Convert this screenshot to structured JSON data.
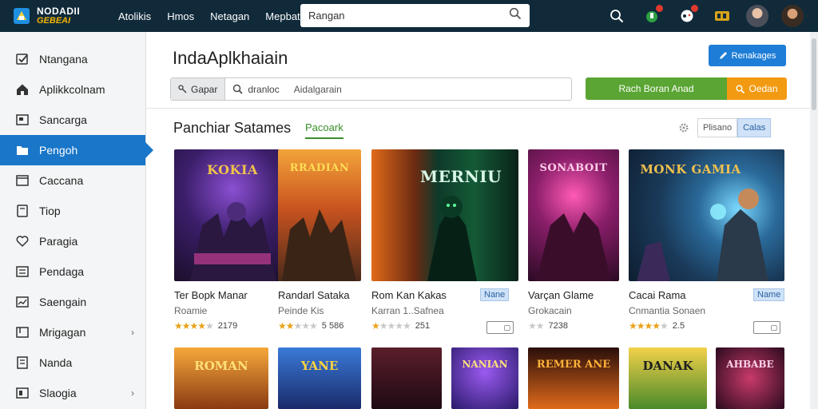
{
  "app": {
    "logo_line1": "NODADII",
    "logo_line2": "GEBEAI"
  },
  "topnav": [
    "Atolikis",
    "Hmos",
    "Netagan",
    "Mepbat"
  ],
  "top_search": {
    "value": "Rangan"
  },
  "sidebar": {
    "items": [
      {
        "label": "Ntangana",
        "icon": "checkbox-icon",
        "chevron": false,
        "active": false
      },
      {
        "label": "Aplikkcolnam",
        "icon": "home-icon",
        "chevron": false,
        "active": false
      },
      {
        "label": "Sancarga",
        "icon": "screen-icon",
        "chevron": false,
        "active": false
      },
      {
        "label": "Pengoh",
        "icon": "folder-icon",
        "chevron": false,
        "active": true
      },
      {
        "label": "Caccana",
        "icon": "window-icon",
        "chevron": false,
        "active": false
      },
      {
        "label": "Tiop",
        "icon": "tablet-icon",
        "chevron": false,
        "active": false
      },
      {
        "label": "Paragia",
        "icon": "heart-icon",
        "chevron": false,
        "active": false
      },
      {
        "label": "Pendaga",
        "icon": "list-icon",
        "chevron": false,
        "active": false
      },
      {
        "label": "Saengain",
        "icon": "chart-icon",
        "chevron": false,
        "active": false
      },
      {
        "label": "Mrigagan",
        "icon": "frame-icon",
        "chevron": true,
        "active": false
      },
      {
        "label": "Nanda",
        "icon": "document-icon",
        "chevron": false,
        "active": false
      },
      {
        "label": "Slaogia",
        "icon": "box-icon",
        "chevron": true,
        "active": false
      }
    ]
  },
  "main": {
    "title": "IndaAplkhaiain",
    "primary_button": "Renakages",
    "filter": {
      "chip": "Gapar",
      "scope": "dranloc",
      "value": "Aidalgarain"
    },
    "split_button": {
      "green": "Rach Boran Anad",
      "orange": "Oedan"
    },
    "section_title": "Panchiar Satames",
    "section_tab": "Pacoark",
    "view_options": [
      "Plisano",
      "Calas"
    ]
  },
  "cards": [
    {
      "title_art": "KOKIA",
      "name": "Ter Bopk Manar",
      "dev": "Roamie",
      "rating": 4,
      "count": "2179",
      "tag": ""
    },
    {
      "title_art": "RRADIAN",
      "name": "Randarl Sataka",
      "dev": "Peinde Kis",
      "rating": 2,
      "count": "5 586",
      "tag": ""
    },
    {
      "title_art": "MERNIU",
      "name": "Rom Kan Kakas",
      "dev": "Karran 1..Safnea",
      "rating": 1,
      "count": "251",
      "tag": "Nane"
    },
    {
      "title_art": "SONABOIT",
      "name": "Varçan Glame",
      "dev": "Grokacain",
      "rating": 0,
      "count": "7238",
      "tag": ""
    },
    {
      "title_art": "MONK GAMIA",
      "name": "Cacai Rama",
      "dev": "Cnmantia Sonaen",
      "rating": 4,
      "count": "2.5",
      "tag": "Name"
    }
  ],
  "row2": [
    "ROMAN",
    "YANE",
    "",
    "NANIAN",
    "REMER ANE",
    "DANAK",
    "AHBABE"
  ],
  "colors": {
    "topbar": "#102a3a",
    "active": "#1976c8",
    "green": "#5aa533",
    "orange": "#f29b12",
    "primary": "#1e7dd6"
  }
}
